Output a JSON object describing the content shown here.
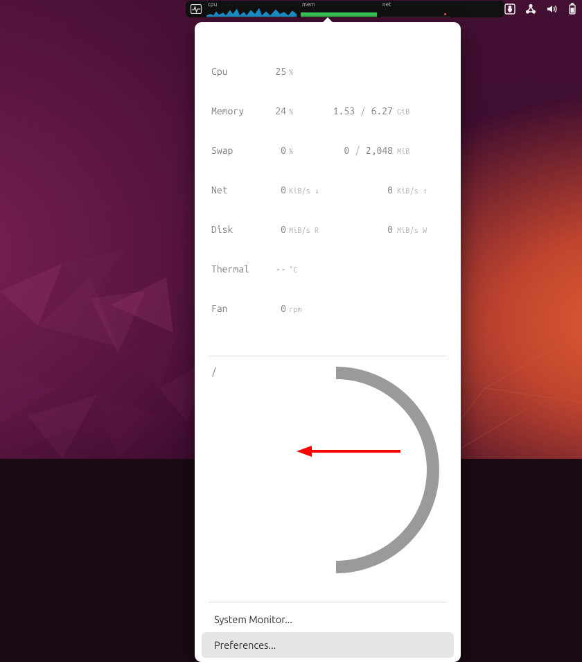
{
  "topbar": {
    "labels": {
      "cpu": "cpu",
      "mem": "mem",
      "net": "net"
    }
  },
  "stats": {
    "cpu": {
      "label": "Cpu",
      "value": "25",
      "unit": "%"
    },
    "memory": {
      "label": "Memory",
      "value": "24",
      "unit": "%",
      "used": "1.53",
      "sep": "/",
      "total": "6.27",
      "unit2": "GiB"
    },
    "swap": {
      "label": "Swap",
      "value": "0",
      "unit": "%",
      "used": "0",
      "sep": "/",
      "total": "2,048",
      "unit2": "MiB"
    },
    "net": {
      "label": "Net",
      "down": "0",
      "down_unit": "KiB/s ↓",
      "up": "0",
      "up_unit": "KiB/s ↑"
    },
    "disk": {
      "label": "Disk",
      "read": "0",
      "read_unit": "MiB/s R",
      "write": "0",
      "write_unit": "MiB/s W"
    },
    "thermal": {
      "label": "Thermal",
      "value": "--",
      "unit": "°C"
    },
    "fan": {
      "label": "Fan",
      "value": "0",
      "unit": "rpm"
    }
  },
  "mount": {
    "path": "/"
  },
  "menu": {
    "system_monitor": "System Monitor...",
    "preferences": "Preferences..."
  }
}
